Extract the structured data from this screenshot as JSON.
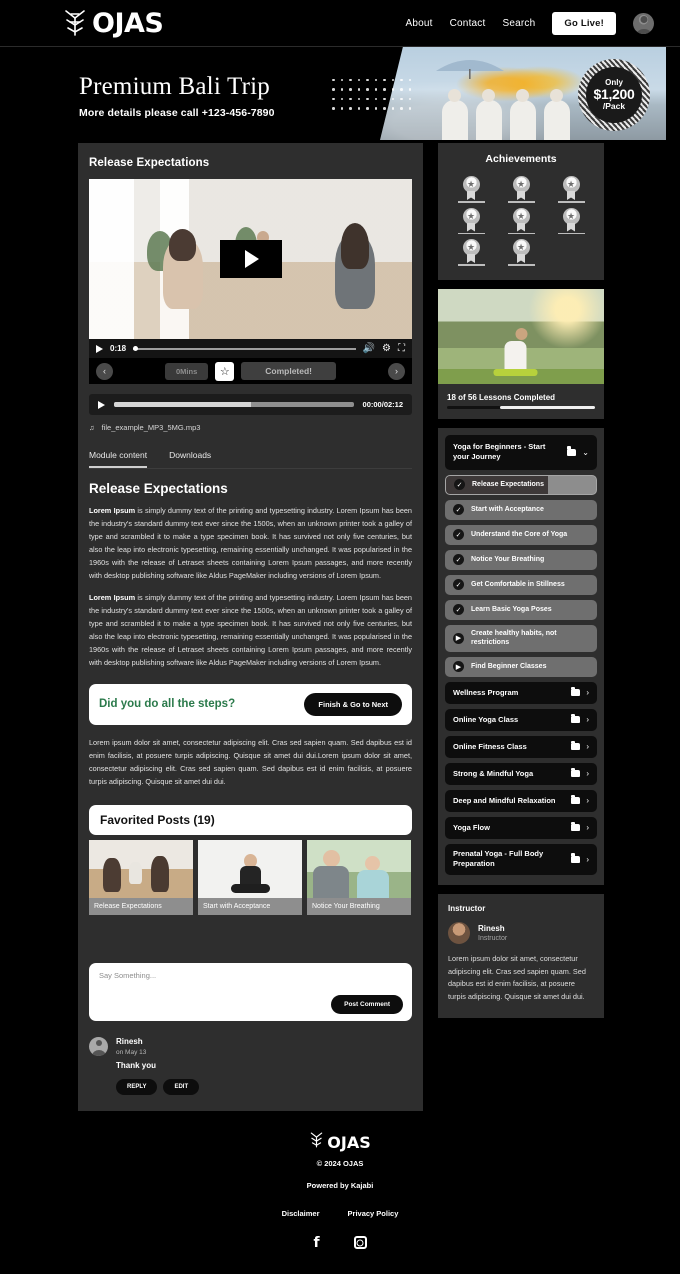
{
  "header": {
    "logo_text": "OJAS",
    "logo_icon": "ojas-glyph-icon",
    "nav": [
      {
        "label": "About"
      },
      {
        "label": "Contact"
      },
      {
        "label": "Search"
      }
    ],
    "go_live_label": "Go Live!",
    "avatar_icon": "user-avatar-icon"
  },
  "hero": {
    "title": "Premium Bali Trip",
    "subtitle": "More details please call +123-456-7890",
    "price_only": "Only",
    "price_amount": "$1,200",
    "price_unit": "/Pack"
  },
  "lesson": {
    "title": "Release Expectations",
    "video": {
      "play_icon": "play-icon",
      "current_time": "0:18",
      "volume_icon": "volume-icon",
      "settings_icon": "gear-icon",
      "fullscreen_icon": "fullscreen-icon",
      "prev_icon": "chevron-left-icon",
      "next_icon": "chevron-right-icon",
      "mins_label": "0Mins",
      "star_icon": "star-icon",
      "completed_label": "Completed!"
    },
    "audio": {
      "play_icon": "play-icon",
      "time": "00:00/02:12",
      "file_icon": "music-note-icon",
      "file_name": "file_example_MP3_5MG.mp3"
    },
    "tabs": [
      {
        "label": "Module content",
        "active": true
      },
      {
        "label": "Downloads",
        "active": false
      }
    ],
    "body_heading": "Release Expectations",
    "paragraphs": [
      {
        "lead": "Lorem Ipsum",
        "text": " is simply dummy text of the printing and typesetting industry. Lorem Ipsum has been the industry's standard dummy text ever since the 1500s, when an unknown printer took a galley of type and scrambled it to make a type specimen book. It has survived not only five centuries, but also the leap into electronic typesetting, remaining essentially unchanged. It was popularised in the 1960s with the release of Letraset sheets containing Lorem Ipsum passages, and more recently with desktop publishing software like Aldus PageMaker including versions of Lorem Ipsum."
      },
      {
        "lead": "Lorem Ipsum",
        "text": " is simply dummy text of the printing and typesetting industry. Lorem Ipsum has been the industry's standard dummy text ever since the 1500s, when an unknown printer took a galley of type and scrambled it to make a type specimen book. It has survived not only five centuries, but also the leap into electronic typesetting, remaining essentially unchanged. It was popularised in the 1960s with the release of Letraset sheets containing Lorem Ipsum passages, and more recently with desktop publishing software like Aldus PageMaker including versions of Lorem Ipsum."
      }
    ],
    "steps_question": "Did you do all the steps?",
    "steps_button": "Finish & Go to Next",
    "steps_note": "Lorem ipsum dolor sit amet, consectetur adipiscing elit. Cras sed sapien quam. Sed dapibus est id enim facilisis, at posuere turpis adipiscing. Quisque sit amet dui dui.Lorem ipsum dolor sit amet, consectetur adipiscing elit. Cras sed sapien quam. Sed dapibus est id enim facilisis, at posuere turpis adipiscing. Quisque sit amet dui dui."
  },
  "favorited": {
    "title": "Favorited Posts (19)",
    "items": [
      {
        "caption": "Release Expectations"
      },
      {
        "caption": "Start with Acceptance"
      },
      {
        "caption": "Notice Your Breathing"
      }
    ]
  },
  "comments": {
    "placeholder": "Say Something...",
    "post_label": "Post Comment",
    "entries": [
      {
        "avatar_icon": "user-avatar-icon",
        "name": "Rinesh",
        "date": "on May 13",
        "text": "Thank you",
        "reply_label": "REPLY",
        "edit_label": "EDIT"
      }
    ]
  },
  "achievements": {
    "title": "Achievements",
    "badge_icon": "medal-star-icon",
    "count": 8
  },
  "progress": {
    "label": "18 of 56 Lessons Completed",
    "completed": 18,
    "total": 56,
    "percent": 64
  },
  "module": {
    "header_title": "Yoga for Beginners - Start your Journey",
    "folder_icon": "folder-icon",
    "chevron_icon": "chevron-down-icon",
    "lessons": [
      {
        "label": "Release Expectations",
        "icon": "check-circle-icon",
        "state": "active"
      },
      {
        "label": "Start with Acceptance",
        "icon": "check-circle-icon",
        "state": "done"
      },
      {
        "label": "Understand the Core of Yoga",
        "icon": "check-circle-icon",
        "state": "done"
      },
      {
        "label": "Notice Your Breathing",
        "icon": "check-circle-icon",
        "state": "done"
      },
      {
        "label": "Get Comfortable in Stillness",
        "icon": "check-circle-icon",
        "state": "done"
      },
      {
        "label": "Learn Basic Yoga Poses",
        "icon": "check-circle-icon",
        "state": "done"
      },
      {
        "label": "Create healthy habits, not restrictions",
        "icon": "play-circle-icon",
        "state": "locked"
      },
      {
        "label": "Find Beginner Classes",
        "icon": "play-circle-icon",
        "state": "locked"
      }
    ],
    "folders": [
      {
        "label": "Wellness Program"
      },
      {
        "label": "Online Yoga Class"
      },
      {
        "label": "Online Fitness Class"
      },
      {
        "label": "Strong & Mindful Yoga"
      },
      {
        "label": "Deep and Mindful Relaxation"
      },
      {
        "label": "Yoga Flow"
      },
      {
        "label": "Prenatal Yoga - Full Body Preparation"
      }
    ]
  },
  "instructor": {
    "heading": "Instructor",
    "avatar_icon": "instructor-avatar-icon",
    "name": "Rinesh",
    "role": "Instructor",
    "bio": "Lorem ipsum dolor sit amet, consectetur adipiscing elit. Cras sed sapien quam. Sed dapibus est id enim facilisis, at posuere turpis adipiscing. Quisque sit amet dui dui."
  },
  "footer": {
    "logo_text": "OJAS",
    "copyright": "© 2024 OJAS",
    "powered_by": "Powered by Kajabi",
    "links": [
      {
        "label": "Disclaimer"
      },
      {
        "label": "Privacy Policy"
      }
    ],
    "social": [
      {
        "icon": "facebook-icon",
        "glyph": "f"
      },
      {
        "icon": "instagram-icon",
        "glyph": ""
      }
    ]
  },
  "colors": {
    "background": "#000000",
    "card": "#2e2e2e",
    "accent_green": "#2b7a4b",
    "white": "#ffffff"
  }
}
